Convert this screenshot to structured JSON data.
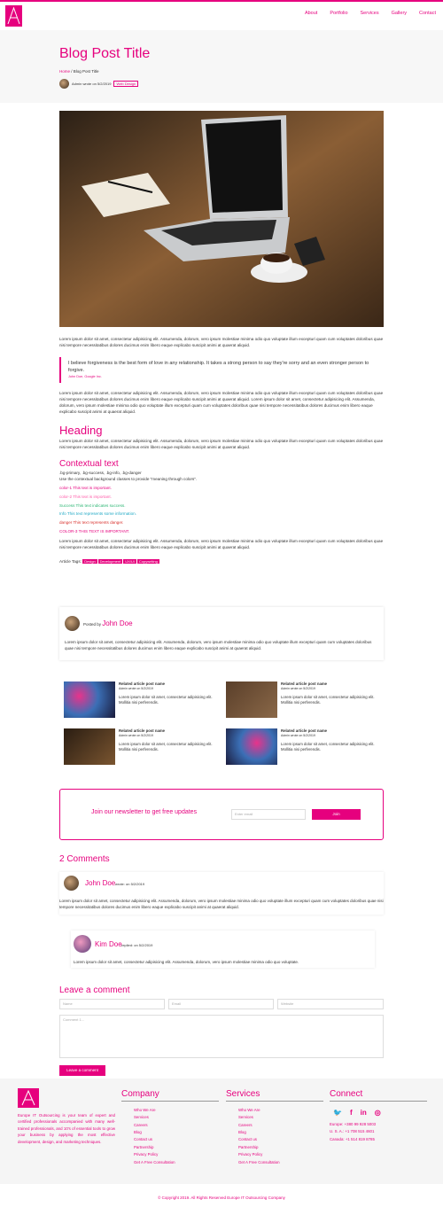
{
  "nav": {
    "items": [
      "About",
      "Portfolio",
      "Services",
      "Gallery",
      "Contact"
    ]
  },
  "hero": {
    "title": "Blog Post Title",
    "crumb_home": "Home",
    "crumb_current": "Blog Post Title",
    "author_text": "Admin wrote on 5/2/2019",
    "category": "Web Design"
  },
  "article": {
    "p1": "Lorem ipsum dolor sit amet, consectetur adipisicing elit. Assumenda, dolorum, vero ipsum molestiae minima odio quo voluptate illum excepturi quam cum voluptates doloribus quae nisi tempore necessitatibus dolores ducimus enim libero eaque explicabo suscipit animi at quaerat aliquid.",
    "quote": "I believe forgiveness is the best form of love in any relationship. It takes a strong person to say they're sorry and an even stronger person to forgive.",
    "quote_source": "John Doe, Google Inc.",
    "p2": "Lorem ipsum dolor sit amet, consectetur adipisicing elit. Assumenda, dolorum, vero ipsum molestiae minima odio quo voluptate illum excepturi quam cum voluptates doloribus quae nisi tempore necessitatibus dolores ducimus enim libero eaque explicabo suscipit animi at quaerat aliquid. Lorem ipsum dolor sit amet, consectetur adipisicing elit. Assumenda, dolorum, vero ipsum molestiae minima odio quo voluptate illum excepturi quam cum voluptates doloribus quae nisi tempore necessitatibus dolores ducimus enim libero eaque explicabo suscipit animi at quaerat aliquid.",
    "heading": "Heading",
    "p3": "Lorem ipsum dolor sit amet, consectetur adipisicing elit. Assumenda, dolorum, vero ipsum molestiae minima odio quo voluptate illum excepturi quam cum voluptates doloribus quae nisi tempore necessitatibus dolores ducimus enim libero eaque explicabo suscipit animi at quaerat aliquid.",
    "subheading": "Contextual text",
    "classes_line": ".bg-primary, .bg-success, .bg-info, .bg-danger",
    "classes_desc": "Use the contextual background classes to provide \"meaning through colors\".",
    "ctx": [
      {
        "text": "color-1 This text is important.",
        "color": "#e6007e"
      },
      {
        "text": "color-2 This text is important.",
        "color": "#ff5aa8"
      },
      {
        "text": "Success This text indicates success.",
        "color": "#2bb673"
      },
      {
        "text": "Info This text represents some information.",
        "color": "#20a9c5"
      },
      {
        "text": "danger This text represents danger.",
        "color": "#d9302c"
      },
      {
        "text": "COLOR-3 THIS TEXT IS IMPORTANT.",
        "color": "#e6007e"
      }
    ],
    "p4": "Lorem ipsum dolor sit amet, consectetur adipisicing elit. Assumenda, dolorum, vero ipsum molestiae minima odio quo voluptate illum excepturi quam cum voluptates doloribus quae nisi tempore necessitatibus dolores ducimus enim libero eaque explicabo suscipit animi at quaerat aliquid.",
    "tags_label": "Article Tags:",
    "tags": [
      "Design",
      "Development",
      "UX/UI",
      "Copywriting"
    ]
  },
  "author_box": {
    "posted_by": "Posted by",
    "name": "John Doe",
    "bio": "Lorem ipsum dolor sit amet, consectetur adipisicing elit. Assumenda, dolorum, vero ipsum molestiae minima odio quo voluptate illum excepturi quam cum voluptates doloribus quae nisi tempore necessitatibus dolores ducimus enim libero eaque explicabo suscipit animi at quaerat aliquid."
  },
  "related": [
    {
      "title": "Related article post name",
      "meta": "Admin wrote on 5/2/2019",
      "text": "Lorem ipsum dolor sit amet, consectetur adipisicing elit. Mollitia nisi perferendis."
    },
    {
      "title": "Related article post name",
      "meta": "Admin wrote on 5/2/2019",
      "text": "Lorem ipsum dolor sit amet, consectetur adipisicing elit. Mollitia nisi perferendis."
    },
    {
      "title": "Related article post name",
      "meta": "Admin wrote on 5/2/2019",
      "text": "Lorem ipsum dolor sit amet, consectetur adipisicing elit. Mollitia nisi perferendis."
    },
    {
      "title": "Related article post name",
      "meta": "Admin wrote on 5/2/2019",
      "text": "Lorem ipsum dolor sit amet, consectetur adipisicing elit. Mollitia nisi perferendis."
    }
  ],
  "newsletter": {
    "text": "Join our newsletter to get free updates",
    "placeholder": "Enter email",
    "button": "Join"
  },
  "comments": {
    "title": "2 Comments",
    "c1_name": "John Doe",
    "c1_meta": "wrote: on 5/2/2019",
    "c1_text": "Lorem ipsum dolor sit amet, consectetur adipisicing elit. Assumenda, dolorum, vero ipsum molestiae minima odio quo voluptate illum excepturi quam cum voluptates doloribus quae nisi tempore necessitatibus dolores ducimus enim libero eaque explicabo suscipit animi at quaerat aliquid.",
    "c2_name": "Kim Doe",
    "c2_meta": "replied: on 5/2/2019",
    "c2_text": "Lorem ipsum dolor sit amet, consectetur adipisicing elit. Assumenda, dolorum, vero ipsum molestiae minima odio quo voluptate."
  },
  "form": {
    "title": "Leave a comment",
    "name": "Name",
    "email": "Email",
    "website": "Website",
    "comment": "Comment 1...",
    "button": "Leave a comment"
  },
  "footer": {
    "about": "Europe IT Outsourcing is your team of expert and certified professionals accompanied with many well-trained professionals, and 10's of essential tools to grow your business by applying the most effective development, design, and marketing techniques.",
    "company_title": "Company",
    "company_links": [
      "Who We Are",
      "Services",
      "Careers",
      "Blog",
      "Contact us",
      "Partnership",
      "Privacy Policy",
      "Get A Free Consultation"
    ],
    "services_title": "Services",
    "services_links": [
      "Who We Are",
      "Services",
      "Careers",
      "Blog",
      "Contact us",
      "Partnership",
      "Privacy Policy",
      "Get A Free Consultation"
    ],
    "connect_title": "Connect",
    "phones": [
      "Europe: +380 99 928 5003",
      "U. S. A.: +1 708 515 4601",
      "Canada: +1 514 819 8785"
    ],
    "copyright": "© Copyright 2019. All Rights Reserved Europe IT Outsourcing Company"
  }
}
